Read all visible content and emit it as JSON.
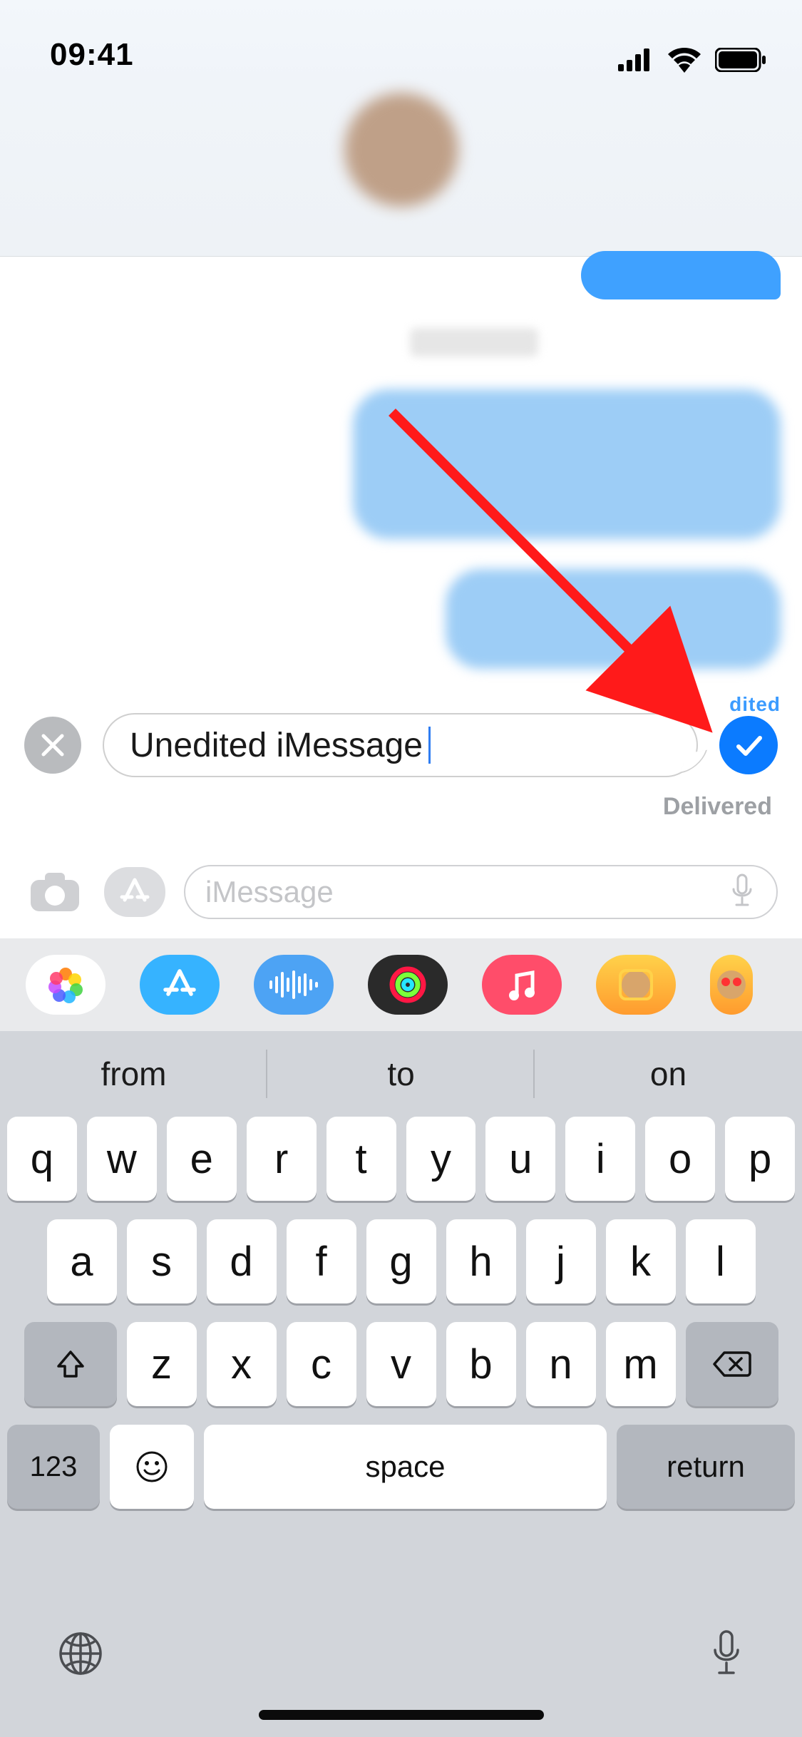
{
  "status": {
    "time": "09:41"
  },
  "edit": {
    "text": "Unedited iMessage",
    "delivered_label": "Delivered",
    "edited_fragment": "dited"
  },
  "input": {
    "placeholder": "iMessage"
  },
  "suggestions": [
    "from",
    "to",
    "on"
  ],
  "keyboard": {
    "row1": [
      "q",
      "w",
      "e",
      "r",
      "t",
      "y",
      "u",
      "i",
      "o",
      "p"
    ],
    "row2": [
      "a",
      "s",
      "d",
      "f",
      "g",
      "h",
      "j",
      "k",
      "l"
    ],
    "row3": [
      "z",
      "x",
      "c",
      "v",
      "b",
      "n",
      "m"
    ],
    "symbols_label": "123",
    "space_label": "space",
    "return_label": "return"
  },
  "app_strip": [
    "photos",
    "app-store",
    "voice-memos",
    "fitness",
    "music",
    "memoji",
    "memoji-2"
  ]
}
